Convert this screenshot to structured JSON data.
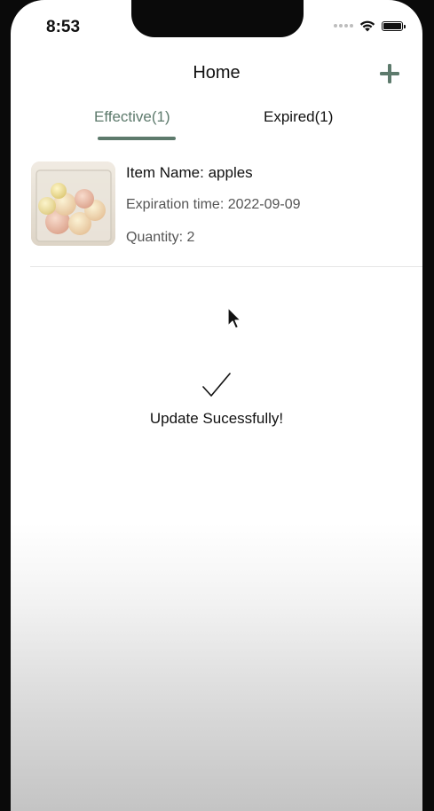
{
  "status_bar": {
    "time": "8:53",
    "icons": [
      "signal-dots-icon",
      "wifi-icon",
      "battery-icon"
    ]
  },
  "nav": {
    "title": "Home",
    "add_icon": "plus-icon",
    "accent_color": "#5d7a6c"
  },
  "tabs": [
    {
      "label": "Effective(1)",
      "active": true
    },
    {
      "label": "Expired(1)",
      "active": false
    }
  ],
  "items": [
    {
      "name_line": "Item Name: apples",
      "expiration_line": "Expiration time: 2022-09-09",
      "quantity_line": "Quantity: 2",
      "thumbnail": "apples-in-glass-container-photo"
    }
  ],
  "toast": {
    "icon": "checkmark-icon",
    "message": "Update Sucessfully!"
  }
}
